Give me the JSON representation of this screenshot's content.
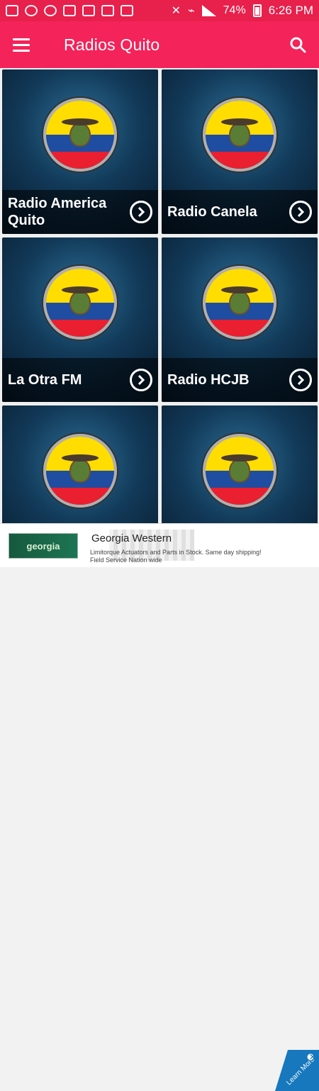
{
  "status_bar": {
    "battery": "74%",
    "time": "6:26 PM"
  },
  "app_bar": {
    "title": "Radios Quito"
  },
  "stations": [
    {
      "name": "Radio America Quito"
    },
    {
      "name": "Radio Canela"
    },
    {
      "name": "La Otra FM"
    },
    {
      "name": "Radio HCJB"
    },
    {
      "name": ""
    },
    {
      "name": ""
    }
  ],
  "ad": {
    "logo_text": "georgia",
    "title": "Georgia Western",
    "description": "Limitorque Actuators and Parts in Stock. Same day shipping! Field Service Nation wide",
    "badge_text": "Learn More"
  },
  "colors": {
    "app_bar": "#f4235a",
    "status_bar": "#e8204c"
  }
}
